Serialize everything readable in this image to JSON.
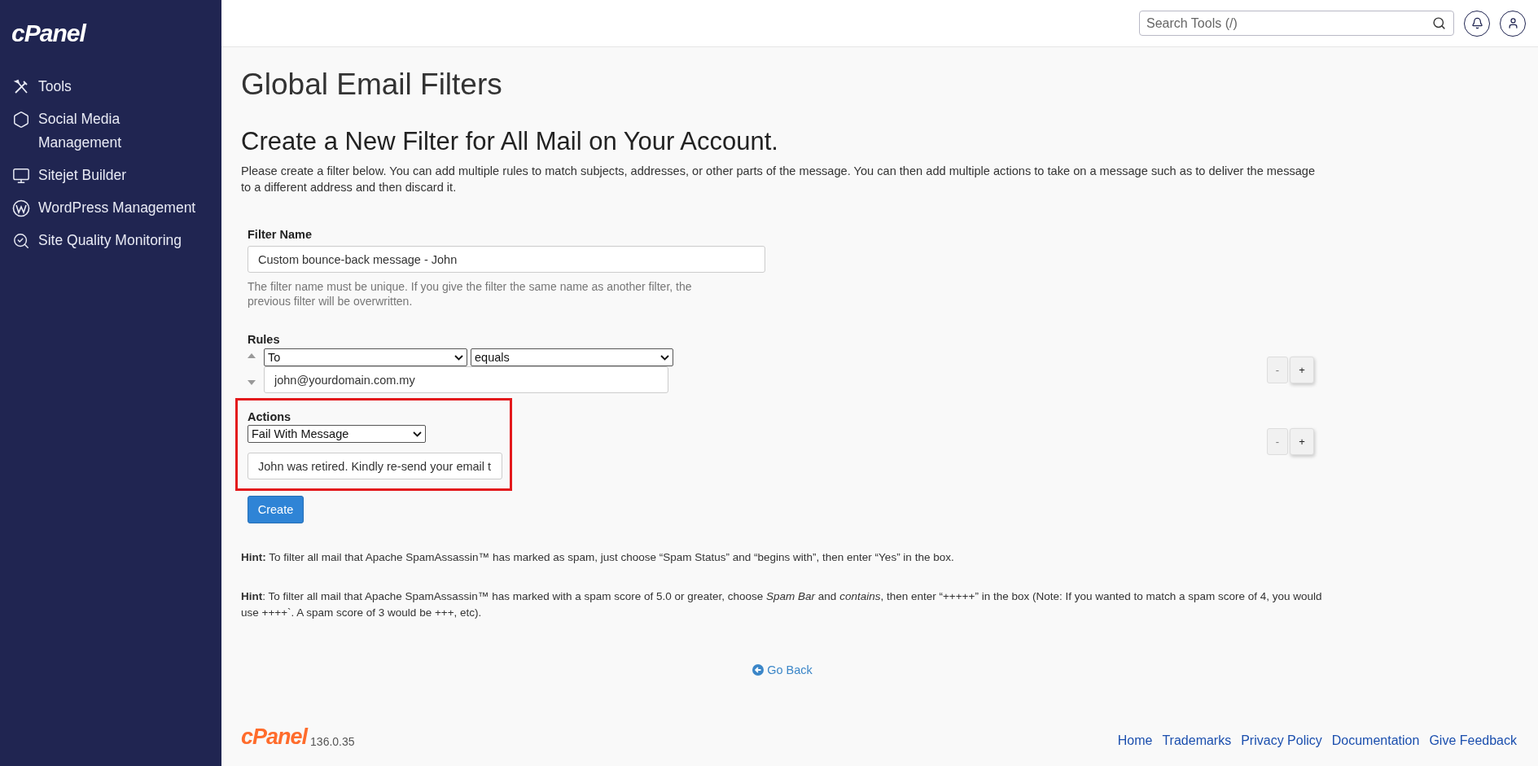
{
  "sidebar": {
    "logo": "cPanel",
    "items": [
      {
        "label": "Tools"
      },
      {
        "label": "Social Media Management"
      },
      {
        "label": "Sitejet Builder"
      },
      {
        "label": "WordPress Management"
      },
      {
        "label": "Site Quality Monitoring"
      }
    ]
  },
  "topbar": {
    "search": {
      "placeholder": "Search Tools (/)"
    }
  },
  "page_title": "Global Email Filters",
  "heading": "Create a New Filter for All Mail on Your Account.",
  "intro": "Please create a filter below. You can add multiple rules to match subjects, addresses, or other parts of the message. You can then add multiple actions to take on a message such as to deliver the message to a different address and then discard it.",
  "filter_name": {
    "label": "Filter Name",
    "value": "Custom bounce-back message - John",
    "help": "The filter name must be unique. If you give the filter the same name as another filter, the previous filter will be overwritten."
  },
  "rules": {
    "label": "Rules",
    "items": [
      {
        "field": "To",
        "operator": "equals",
        "value": "john@yourdomain.com.my"
      }
    ],
    "buttons": [
      "-",
      "+"
    ]
  },
  "actions": {
    "label": "Actions",
    "highlighted": true,
    "items": [
      {
        "action": "Fail With Message",
        "value": "John was retired. Kindly re-send your email t"
      }
    ],
    "buttons": [
      "-",
      "+"
    ]
  },
  "create_button": "Create",
  "hints": [
    "**Hint:** To filter all mail that Apache SpamAssassin™ has marked as spam, just choose “Spam Status” and “begins with”, then enter “Yes” in the box.",
    "**Hint**: To filter all mail that Apache SpamAssassin™ has marked with a spam score of 5.0 or greater, choose *Spam Bar* and *contains*, then enter “+++++” in the box (Note: If you wanted to match a spam score of 4, you would use ++++`. A spam score of 3 would be +++, etc)."
  ],
  "go_back": "Go Back",
  "footer": {
    "logo": "cPanel",
    "version": "136.0.35",
    "links": [
      "Home",
      "Trademarks",
      "Privacy Policy",
      "Documentation",
      "Give Feedback"
    ]
  }
}
